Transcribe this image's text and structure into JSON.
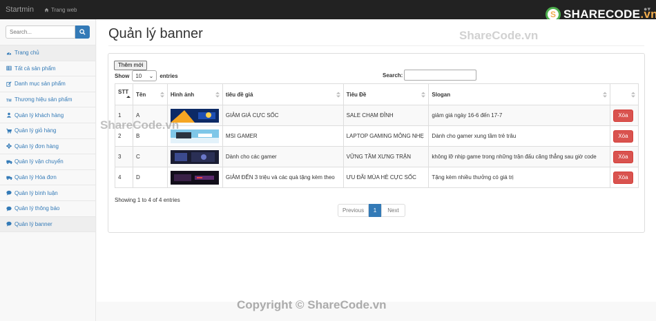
{
  "topbar": {
    "brand": "Startmin",
    "home_link": "Trang web",
    "logo": {
      "main": "SHARECODE",
      "tld": ".vn",
      "mark": "S"
    }
  },
  "sidebar": {
    "search_placeholder": "Search...",
    "items": [
      {
        "label": "Trang chủ",
        "icon": "dashboard-icon"
      },
      {
        "label": "Tất cả sản phẩm",
        "icon": "table-icon"
      },
      {
        "label": "Danh mục sản phẩm",
        "icon": "edit-icon"
      },
      {
        "label": "Thương hiệu sản phẩm",
        "icon": "trademark-icon"
      },
      {
        "label": "Quản lý khách hàng",
        "icon": "user-icon"
      },
      {
        "label": "Quản lý giỏ hàng",
        "icon": "cart-icon"
      },
      {
        "label": "Quản lý đơn hàng",
        "icon": "gear-icon"
      },
      {
        "label": "Quản lý vận chuyển",
        "icon": "truck-icon"
      },
      {
        "label": "Quản lý Hóa đơn",
        "icon": "truck-icon"
      },
      {
        "label": "Quản lý bình luận",
        "icon": "comment-icon"
      },
      {
        "label": "Quản lý thông báo",
        "icon": "comment-icon"
      },
      {
        "label": "Quản lý banner",
        "icon": "comment-icon"
      }
    ]
  },
  "main": {
    "title": "Quản lý banner",
    "add_button": "Thêm mới",
    "show_label": "Show",
    "entries_value": "10",
    "entries_label": "entries",
    "search_label": "Search:",
    "columns": [
      "STT",
      "Tên",
      "Hình ảnh",
      "tiêu đề giá",
      "Tiêu Đề",
      "Slogan",
      ""
    ],
    "rows": [
      {
        "stt": "1",
        "name": "A",
        "price_title": "GIẢM GIÁ CỰC SỐC",
        "title": "SALE CHẠM ĐỈNH",
        "slogan": "giảm giá ngày 16-6 đến 17-7",
        "delete": "Xóa"
      },
      {
        "stt": "2",
        "name": "B",
        "price_title": "MSI GAMER",
        "title": "LAPTOP GAMING MỎNG NHẸ",
        "slogan": "Dành cho gamer xung tầm trẻ trâu",
        "delete": "Xóa"
      },
      {
        "stt": "3",
        "name": "C",
        "price_title": "Dành cho các gamer",
        "title": "VỮNG TẦM XƯNG TRẬN",
        "slogan": "không lỡ nhịp game trong những trận đấu căng thẳng sau giờ code",
        "delete": "Xóa"
      },
      {
        "stt": "4",
        "name": "D",
        "price_title": "GIẢM ĐẾN 3 triệu và các quà tặng kèm theo",
        "title": "ƯU ĐÃI MÙA HÈ CỰC SỐC",
        "slogan": "Tặng kèm nhiều thưởng có giá trị",
        "delete": "Xóa"
      }
    ],
    "info": "Showing 1 to 4 of 4 entries",
    "pagination": {
      "prev": "Previous",
      "page": "1",
      "next": "Next"
    }
  },
  "watermarks": {
    "top": "ShareCode.vn",
    "middle": "ShareCode.vn",
    "bottom": "Copyright © ShareCode.vn"
  },
  "colors": {
    "primary": "#337ab7",
    "danger": "#d9534f",
    "topbar": "#222222"
  }
}
